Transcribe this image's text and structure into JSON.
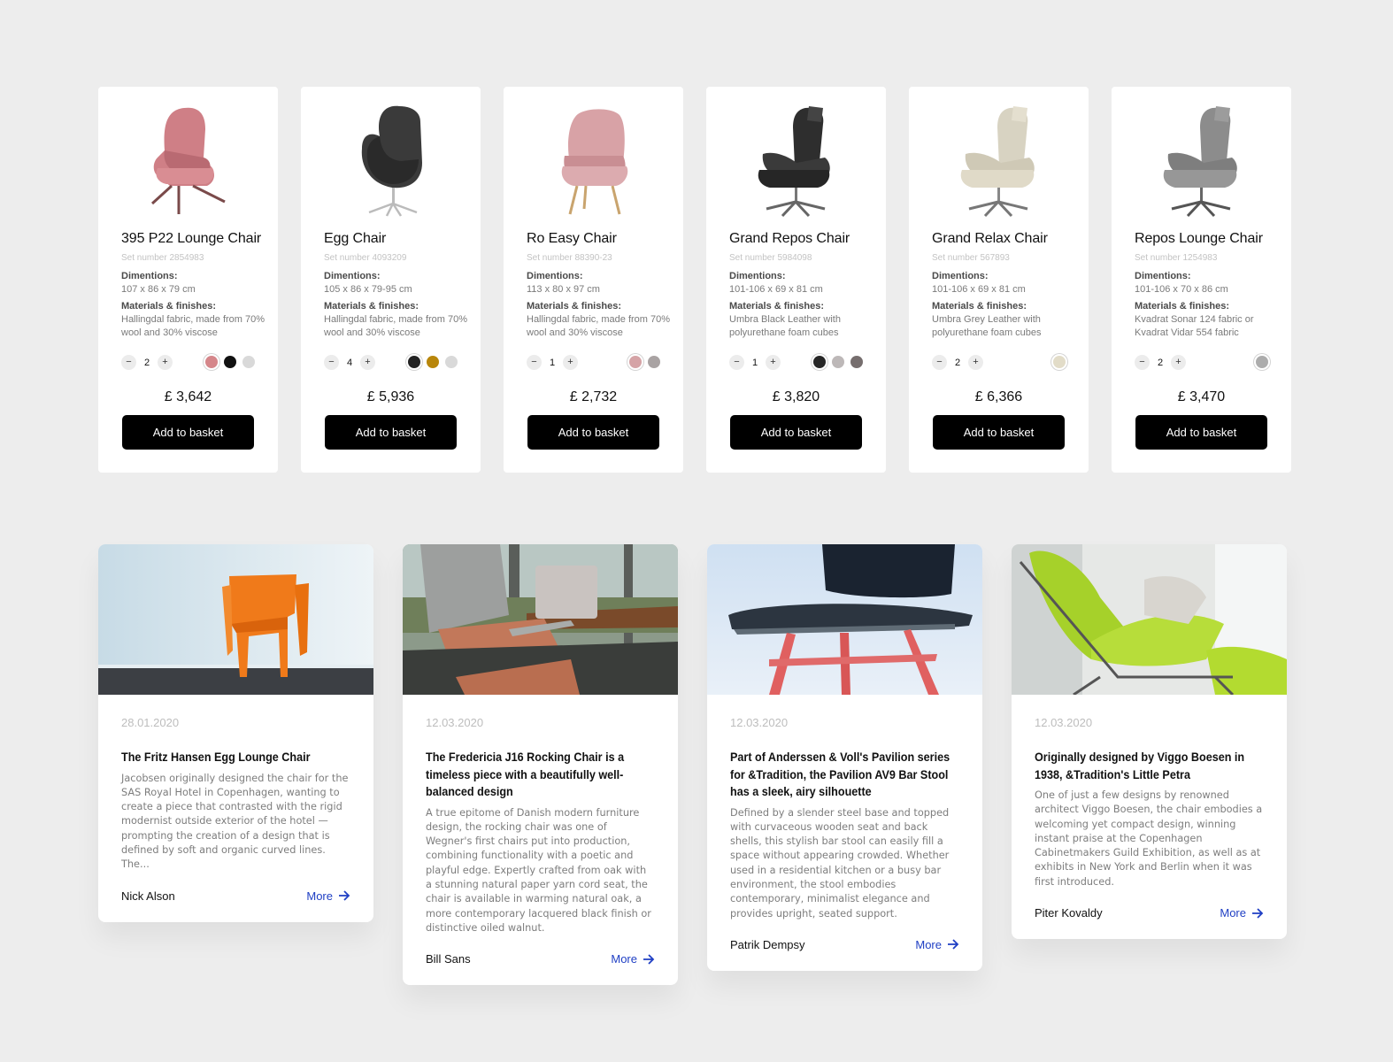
{
  "products": [
    {
      "name": "395 P22 Lounge Chair",
      "set_number": "Set number 2854983",
      "dimensions_label": "Dimentions:",
      "dimensions": "107 x 86 x 79 cm",
      "materials_label": "Materials & finishes:",
      "materials": "Hallingdal fabric, made from 70% wool and 30% viscose",
      "quantity": "2",
      "minus": "−",
      "plus": "+",
      "swatches": [
        "#d5868a",
        "#111111",
        "#d9d9d9"
      ],
      "selected_swatch": 0,
      "price": "£ 3,642",
      "button": "Add to basket",
      "image": "pink-wingback-lounge-chair"
    },
    {
      "name": "Egg Chair",
      "set_number": "Set number 4093209",
      "dimensions_label": "Dimentions:",
      "dimensions": "105 x 86 x 79-95 cm",
      "materials_label": "Materials & finishes:",
      "materials": "Hallingdal fabric, made from 70% wool and 30% viscose",
      "quantity": "4",
      "minus": "−",
      "plus": "+",
      "swatches": [
        "#222222",
        "#b8860b",
        "#d9d9d9"
      ],
      "selected_swatch": 0,
      "price": "£ 5,936",
      "button": "Add to basket",
      "image": "black-egg-chair"
    },
    {
      "name": "Ro Easy Chair",
      "set_number": "Set number 88390-23",
      "dimensions_label": "Dimentions:",
      "dimensions": "113 x 80 x 97 cm",
      "materials_label": "Materials & finishes:",
      "materials": "Hallingdal fabric, made from 70% wool and 30% viscose",
      "quantity": "1",
      "minus": "−",
      "plus": "+",
      "swatches": [
        "#d5a3a6",
        "#a9a3a3"
      ],
      "selected_swatch": 0,
      "price": "£ 2,732",
      "button": "Add to basket",
      "image": "rose-easy-chair"
    },
    {
      "name": "Grand Repos Chair",
      "set_number": "Set number 5984098",
      "dimensions_label": "Dimentions:",
      "dimensions": "101-106 x 69 x 81 cm",
      "materials_label": "Materials & finishes:",
      "materials": "Umbra Black Leather with polyurethane foam cubes",
      "quantity": "1",
      "minus": "−",
      "plus": "+",
      "swatches": [
        "#262626",
        "#bdb8b8",
        "#766e6e"
      ],
      "selected_swatch": 0,
      "price": "£ 3,820",
      "button": "Add to basket",
      "image": "black-leather-recliner"
    },
    {
      "name": "Grand Relax Chair",
      "set_number": "Set number 567893",
      "dimensions_label": "Dimentions:",
      "dimensions": "101-106 x 69 x 81 cm",
      "materials_label": "Materials & finishes:",
      "materials": "Umbra Grey Leather with polyurethane foam cubes",
      "quantity": "2",
      "minus": "−",
      "plus": "+",
      "swatches": [
        "#e2dcc8"
      ],
      "selected_swatch": 0,
      "price": "£ 6,366",
      "button": "Add to basket",
      "image": "beige-relax-chair"
    },
    {
      "name": "Repos Lounge Chair",
      "set_number": "Set number 1254983",
      "dimensions_label": "Dimentions:",
      "dimensions": "101-106 x 70 x 86 cm",
      "materials_label": "Materials & finishes:",
      "materials": "Kvadrat Sonar 124 fabric or Kvadrat Vidar 554 fabric",
      "quantity": "2",
      "minus": "−",
      "plus": "+",
      "swatches": [
        "#acacac"
      ],
      "selected_swatch": 0,
      "price": "£ 3,470",
      "button": "Add to basket",
      "image": "grey-lounge-chair"
    }
  ],
  "posts": [
    {
      "date": "28.01.2020",
      "title": "The Fritz Hansen Egg Lounge Chair",
      "excerpt": "Jacobsen originally designed the chair for the SAS Royal Hotel in Copenhagen, wanting to create a piece that contrasted with the rigid modernist outside exterior of the hotel — prompting the creation of a design that is defined by soft and organic curved lines. The...",
      "author": "Nick Alson",
      "more": "More",
      "image": "orange-chair-photo"
    },
    {
      "date": "12.03.2020",
      "title": "The Fredericia J16 Rocking Chair is a timeless piece with a beautifully well-balanced design",
      "excerpt": "A true epitome of Danish modern furniture design, the rocking chair was one of Wegner's first chairs put into production, combining functionality with a poetic and playful edge. Expertly crafted from oak with a stunning natural paper yarn cord seat, the chair is available in warming natural oak, a more contemporary lacquered black finish or distinctive oiled walnut.",
      "author": "Bill Sans",
      "more": "More",
      "image": "office-chairs-photo"
    },
    {
      "date": "12.03.2020",
      "title": "Part of Anderssen & Voll's Pavilion series for &Tradition, the Pavilion AV9 Bar Stool has a sleek, airy silhouette",
      "excerpt": "Defined by a slender steel base and topped with curvaceous wooden seat and back shells, this stylish bar stool can easily fill a space without appearing crowded. Whether used in a residential kitchen or a busy bar environment, the stool embodies contemporary, minimalist elegance and provides upright, seated support.",
      "author": "Patrik Dempsy",
      "more": "More",
      "image": "red-stool-photo"
    },
    {
      "date": "12.03.2020",
      "title": "Originally designed by Viggo Boesen in 1938, &Tradition's Little Petra",
      "excerpt": "One of just a few designs by renowned architect Viggo Boesen, the chair embodies a welcoming yet compact design, winning instant praise at the Copenhagen Cabinetmakers Guild Exhibition, as well as at exhibits in New York and Berlin when it was first introduced.",
      "author": "Piter Kovaldy",
      "more": "More",
      "image": "green-lounger-photo"
    }
  ]
}
